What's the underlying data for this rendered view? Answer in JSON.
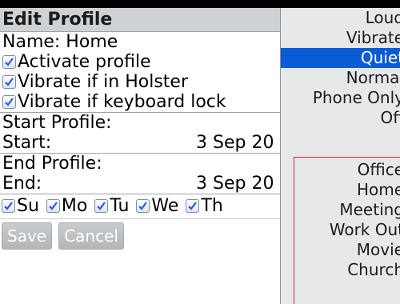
{
  "form": {
    "title": "Edit Profile",
    "name_line": "Name: Home",
    "checkboxes": [
      {
        "label": "Activate profile",
        "checked": true
      },
      {
        "label": "Vibrate if in Holster",
        "checked": true
      },
      {
        "label": "Vibrate if keyboard lock",
        "checked": true
      }
    ],
    "start_heading": "Start Profile:",
    "start_label": "Start:",
    "start_value": "3 Sep 20",
    "end_heading": "End Profile:",
    "end_label": "End:",
    "end_value": "3 Sep 20",
    "days": [
      {
        "label": "Su",
        "checked": true
      },
      {
        "label": "Mo",
        "checked": true
      },
      {
        "label": "Tu",
        "checked": true
      },
      {
        "label": "We",
        "checked": true
      },
      {
        "label": "Th",
        "checked": true
      }
    ],
    "save_label": "Save",
    "cancel_label": "Cancel"
  },
  "dropdown": {
    "items": [
      "Loud",
      "Vibrate",
      "Quiet",
      "Normal",
      "Phone Only",
      "Off"
    ],
    "selected": "Quiet",
    "custom_items": [
      "Office",
      "Home",
      "Meeting",
      "Work Out",
      "Movie",
      "Church"
    ]
  },
  "colors": {
    "selection": "#0a5bd6",
    "custom_border": "#d42b2b",
    "checkmark": "#2a5bd8"
  }
}
